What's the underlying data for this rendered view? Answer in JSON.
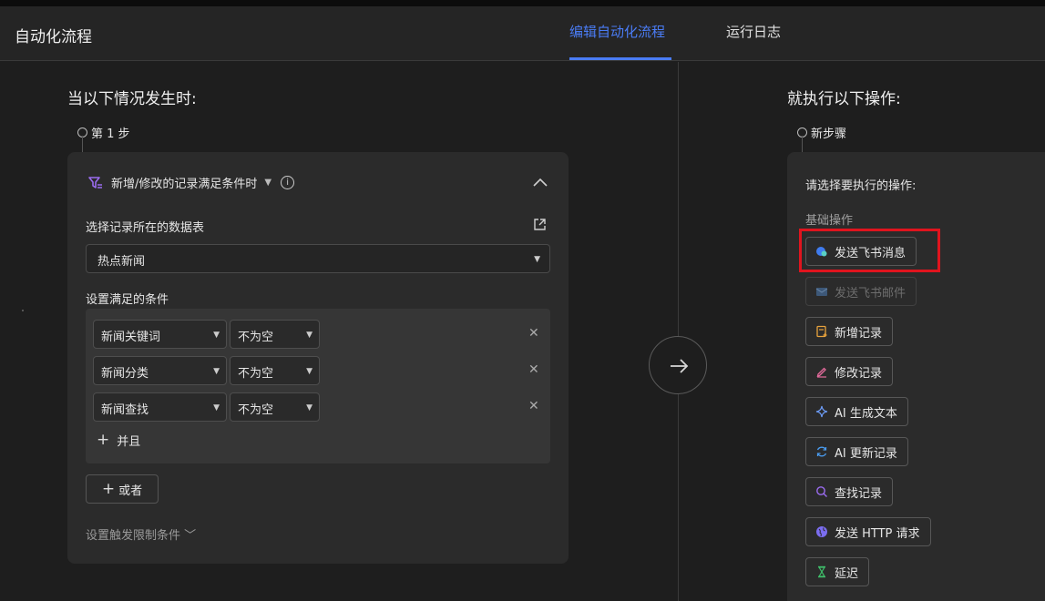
{
  "app_title": "自动化流程",
  "tabs": {
    "edit": "编辑自动化流程",
    "log": "运行日志"
  },
  "left": {
    "title": "当以下情况发生时:",
    "step_label": "第 1 步",
    "trigger": "新增/修改的记录满足条件时",
    "table_label": "选择记录所在的数据表",
    "table_value": "热点新闻",
    "conditions_label": "设置满足的条件",
    "conditions": [
      {
        "field": "新闻关键词",
        "operator": "不为空"
      },
      {
        "field": "新闻分类",
        "operator": "不为空"
      },
      {
        "field": "新闻查找",
        "operator": "不为空"
      }
    ],
    "and_label": "并且",
    "or_label": "或者",
    "limit_label": "设置触发限制条件"
  },
  "right": {
    "title": "就执行以下操作:",
    "step_label": "新步骤",
    "choose_label": "请选择要执行的操作:",
    "basic_label": "基础操作",
    "actions": [
      {
        "label": "发送飞书消息",
        "icon": "feishu-message-icon",
        "disabled": false
      },
      {
        "label": "发送飞书邮件",
        "icon": "mail-icon",
        "disabled": true
      },
      {
        "label": "新增记录",
        "icon": "add-record-icon",
        "disabled": false
      },
      {
        "label": "修改记录",
        "icon": "edit-pen-icon",
        "disabled": false
      },
      {
        "label": "AI 生成文本",
        "icon": "ai-sparkle-icon",
        "disabled": false
      },
      {
        "label": "AI 更新记录",
        "icon": "refresh-icon",
        "disabled": false
      },
      {
        "label": "查找记录",
        "icon": "search-icon",
        "disabled": false
      },
      {
        "label": "发送 HTTP 请求",
        "icon": "globe-icon",
        "disabled": false
      },
      {
        "label": "延迟",
        "icon": "hourglass-icon",
        "disabled": false
      }
    ]
  },
  "colors": {
    "accent": "#4a7cf5",
    "highlight": "#e0141e",
    "background": "#1e1e1e",
    "card": "#2b2b2b"
  }
}
